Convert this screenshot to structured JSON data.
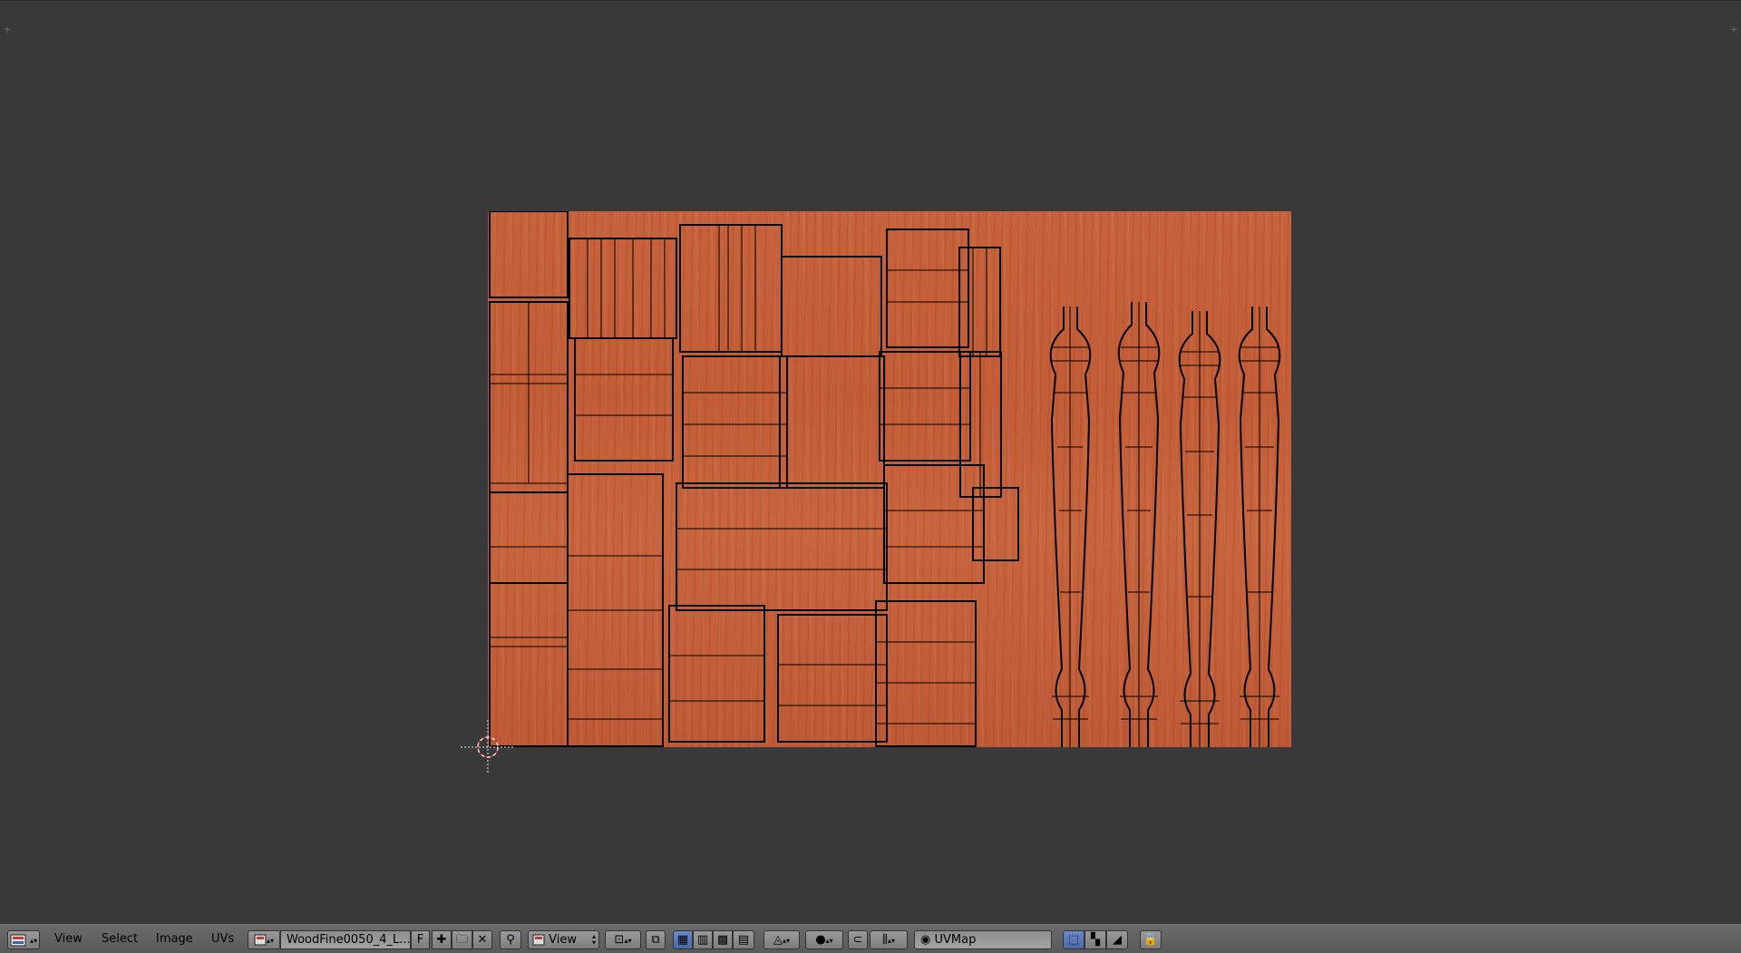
{
  "header": {
    "menus": [
      {
        "key": "view",
        "label": "View"
      },
      {
        "key": "select",
        "label": "Select"
      },
      {
        "key": "image",
        "label": "Image"
      },
      {
        "key": "uvs",
        "label": "UVs"
      }
    ],
    "image_name": "WoodFine0050_4_L...",
    "fake_user_label": "F",
    "view_dropdown": "View",
    "uv_map_name": "UVMap"
  },
  "icons": {
    "editor_type": "image-editor-icon",
    "image_browse": "image-browse-icon",
    "new_image": "plus-icon",
    "open_image": "folder-icon",
    "unlink_image": "close-icon",
    "pin": "pin-icon",
    "mode_dropdown": "image-mode-icon",
    "pivot": "pivot-point-icon",
    "sticky": "sticky-selection-icon",
    "select_modes": [
      "vertex-select-icon",
      "edge-select-icon",
      "face-select-icon",
      "island-select-icon"
    ],
    "proportional": "proportional-edit-icon",
    "falloff": "falloff-sphere-icon",
    "snap": "snap-icon",
    "snap_element": "snap-element-icon",
    "uvmap": "uvmap-icon",
    "render_modes": [
      "uv-test-grid-icon",
      "checker-icon",
      "curve-icon"
    ],
    "lock": "lock-icon"
  },
  "colors": {
    "viewport_bg": "#393939",
    "wood": "#c5603b",
    "header_bg": "#656565",
    "selected_button": "#5577bb"
  }
}
